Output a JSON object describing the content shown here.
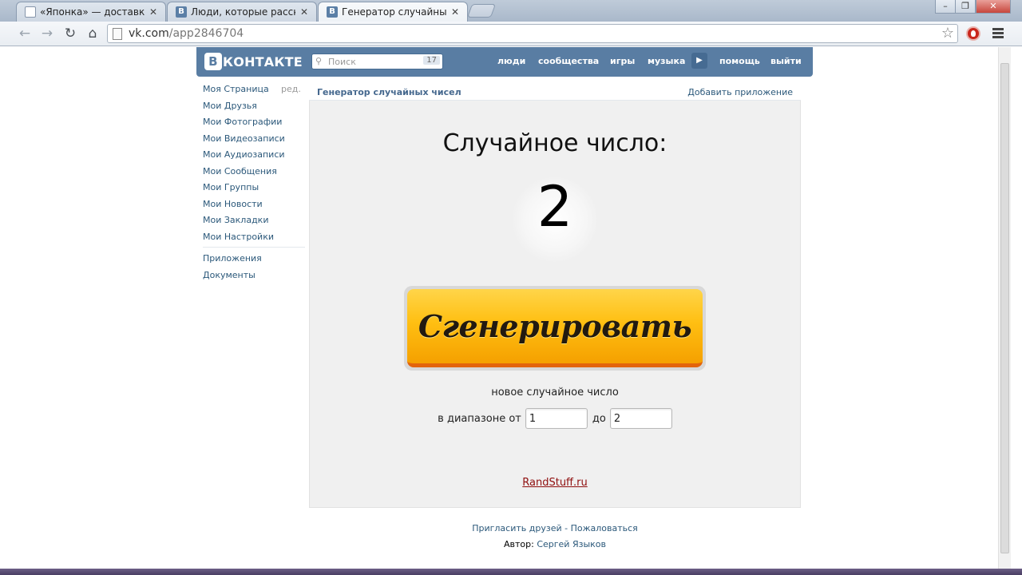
{
  "browser": {
    "tabs": [
      {
        "title": "«Японка» — доставка су",
        "icon": "document-icon"
      },
      {
        "title": "Люди, которые рассказа",
        "icon": "vk-icon"
      },
      {
        "title": "Генератор случайных чи",
        "icon": "vk-icon",
        "active": true
      }
    ],
    "tab_close_glyph": "✕",
    "tab_favicon_letter": "В",
    "url_host": "vk.com",
    "url_path": "/app2846704",
    "window_controls": [
      "–",
      "❐",
      "✕"
    ]
  },
  "vk": {
    "logo_letter": "В",
    "logo_text": "КОНТАКТЕ",
    "search_placeholder": "Поиск",
    "search_count": "17",
    "nav": [
      "люди",
      "сообщества",
      "игры",
      "музыка",
      "помощь",
      "выйти"
    ],
    "sidebar": {
      "edit_label": "ред.",
      "items": [
        "Моя Страница",
        "Мои Друзья",
        "Мои Фотографии",
        "Мои Видеозаписи",
        "Мои Аудиозаписи",
        "Мои Сообщения",
        "Мои Группы",
        "Мои Новости",
        "Мои Закладки",
        "Мои Настройки"
      ],
      "extra_items": [
        "Приложения",
        "Документы"
      ]
    }
  },
  "app": {
    "title": "Генератор случайных чисел",
    "add_label": "Добавить приложение",
    "heading": "Случайное число:",
    "number": "2",
    "button_label": "Сгенерировать",
    "subtitle": "новое случайное число",
    "range_from_label": "в диапазоне от",
    "range_from_value": "1",
    "range_to_label": "до",
    "range_to_value": "2",
    "site_link": "RandStuff.ru"
  },
  "footer": {
    "invite": "Пригласить друзей",
    "separator": " - ",
    "complain": "Пожаловаться",
    "author_label": "Автор:",
    "author_name": "Сергей Языков"
  },
  "colors": {
    "vk_blue": "#597da3",
    "link": "#2b587a",
    "button_orange": "#ffbf12",
    "site_link": "#8f0e0e"
  }
}
